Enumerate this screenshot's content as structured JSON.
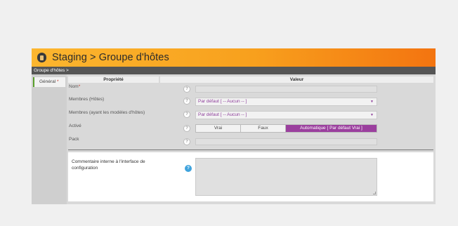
{
  "header": {
    "title": "Staging > Groupe d'hôtes",
    "icon": "database-icon"
  },
  "breadcrumb": "Groupe d'hôtes >",
  "tabs": [
    {
      "label": "Général",
      "required_mark": "*"
    }
  ],
  "columns": {
    "property": "Propriété",
    "value": "Valeur"
  },
  "fields": {
    "nom": {
      "label": "Nom",
      "required_mark": "*",
      "help": "?"
    },
    "membres": {
      "label": "Membres (Hôtes)",
      "value": "Par défaut [ -- Aucun -- ]",
      "help": "?"
    },
    "membres_modeles": {
      "label": "Membres (ayant les modèles d'hôtes)",
      "value": "Par défaut [ -- Aucun -- ]",
      "help": "?"
    },
    "active": {
      "label": "Activé",
      "options": [
        "Vrai",
        "Faux",
        "Automatique [ Par défaut Vrai ]"
      ],
      "selected": "Automatique [ Par défaut Vrai ]",
      "help": "?"
    },
    "pack": {
      "label": "Pack",
      "help": "?"
    }
  },
  "comment": {
    "label": "Commentaire interne à l'interface de configuration",
    "help": "?"
  },
  "colors": {
    "accent_orange": "#f8a01d",
    "selected_purple": "#9b3f9e",
    "help_blue": "#3fa3dd"
  }
}
